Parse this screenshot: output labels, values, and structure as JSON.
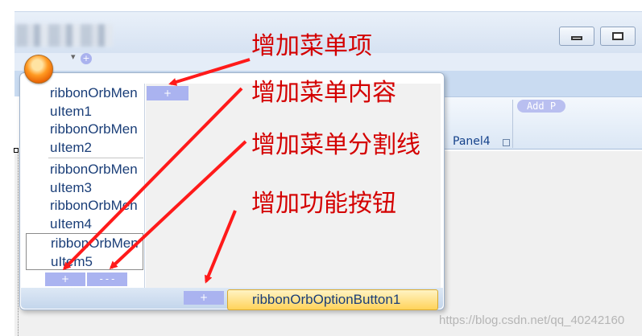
{
  "window": {
    "minimize_icon": "minimize-icon",
    "maximize_icon": "maximize-icon",
    "qat_add_label": "+"
  },
  "ribbon": {
    "add_panel_label": "Add P",
    "panel4_label": "Panel4"
  },
  "orb_menu": {
    "items": [
      {
        "label": "ribbonOrbMenuItem1"
      },
      {
        "label": "ribbonOrbMenuItem2"
      },
      {
        "label": "ribbonOrbMenuItem3"
      },
      {
        "label": "ribbonOrbMenuItem4"
      },
      {
        "label": "ribbonOrbMenuItem5"
      }
    ],
    "add_menu_item_label": "+",
    "left_add_label": "+",
    "add_separator_label": "---",
    "add_option_label": "+",
    "option_button_label": "ribbonOrbOptionButton1"
  },
  "annotations": [
    "增加菜单项",
    "增加菜单内容",
    "增加菜单分割线",
    "增加功能按钮"
  ],
  "colors": {
    "annotation": "#d40000",
    "menu_text": "#1a3e78",
    "add_button": "#aab3f0",
    "option_button": "#ffd35a"
  },
  "watermark": "https://blog.csdn.net/qq_40242160"
}
